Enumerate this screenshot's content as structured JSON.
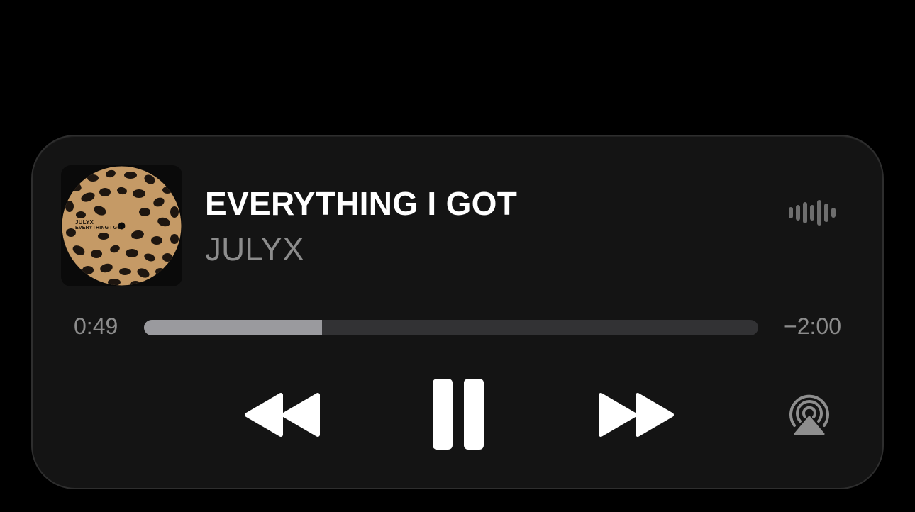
{
  "track": {
    "title": "EVERYTHING I GOT",
    "artist": "JULYX"
  },
  "artwork": {
    "label_artist": "JULYX",
    "label_title": "EVERYTHING I GOT",
    "pattern": "leopard-print",
    "base_color": "#c59a66"
  },
  "playback": {
    "elapsed": "0:49",
    "remaining": "−2:00",
    "progress_fraction": 0.29,
    "state": "playing"
  },
  "controls": {
    "rewind": "rewind-icon",
    "pause": "pause-icon",
    "forward": "fast-forward-icon",
    "airplay": "airplay-icon",
    "waveform": "audio-waveform-icon"
  },
  "colors": {
    "background": "#000000",
    "panel": "#141414",
    "primary_text": "#ffffff",
    "secondary_text": "#8c8c8c",
    "progress_fill": "#9a9a9e",
    "progress_track": "#323234"
  }
}
